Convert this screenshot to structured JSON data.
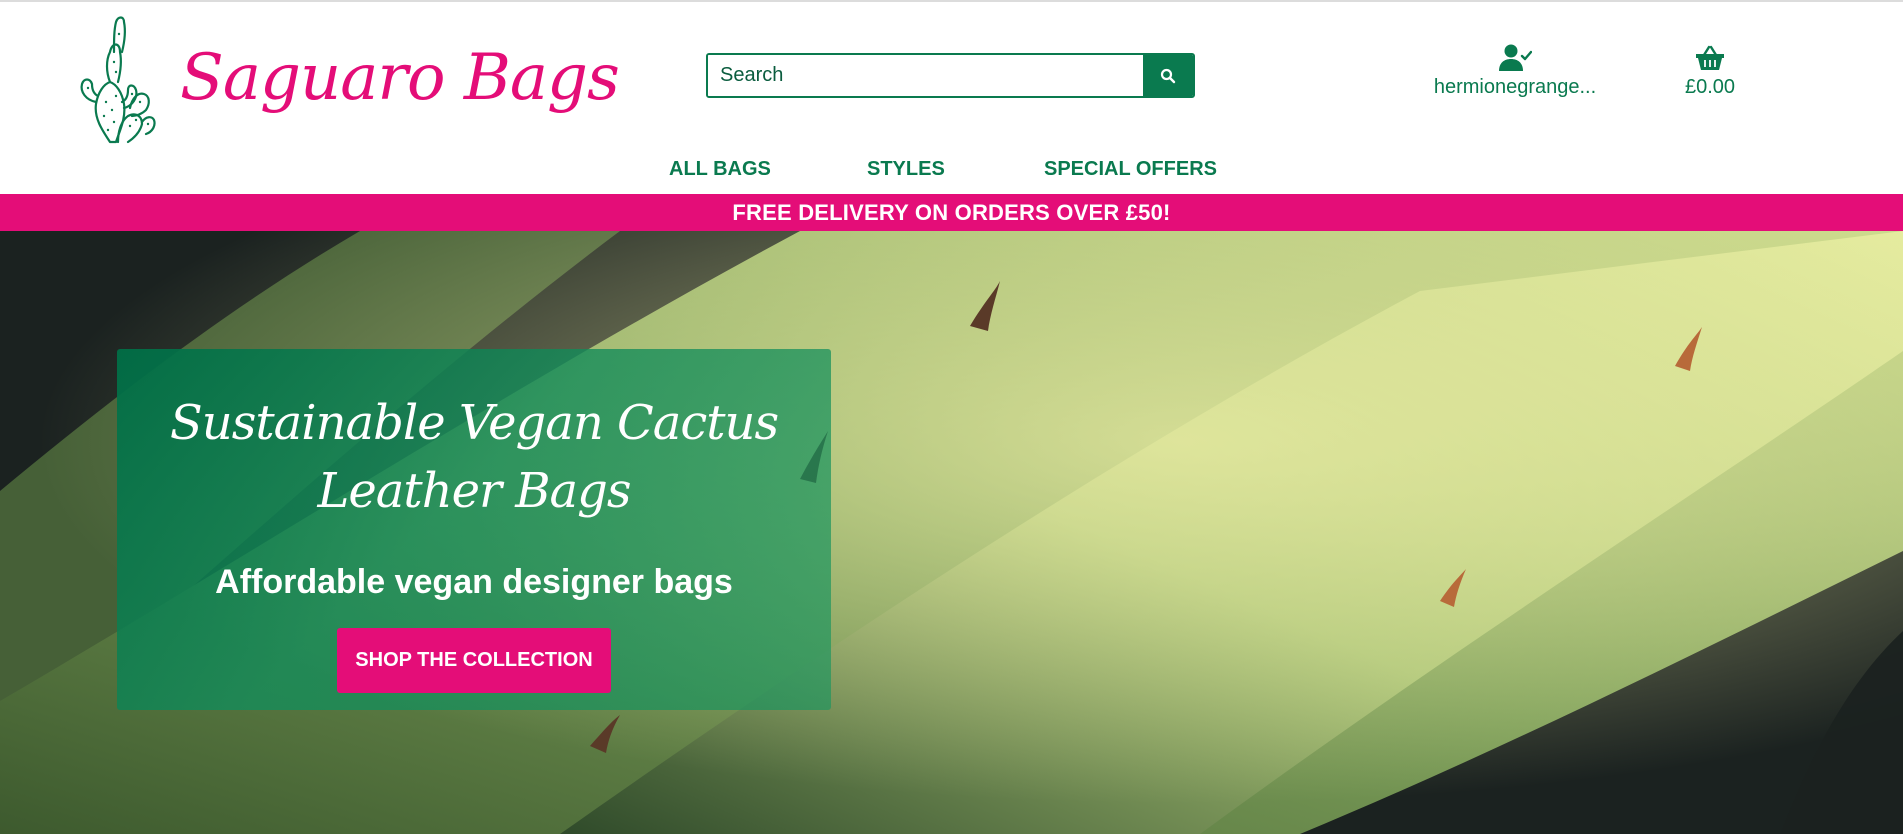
{
  "header": {
    "brand_name": "Saguaro Bags",
    "search": {
      "placeholder": "Search"
    },
    "account": {
      "username": "hermionegrange..."
    },
    "cart": {
      "total": "£0.00"
    }
  },
  "nav": {
    "items": [
      {
        "label": "ALL BAGS"
      },
      {
        "label": "STYLES"
      },
      {
        "label": "SPECIAL OFFERS"
      }
    ]
  },
  "banner": {
    "text": "FREE DELIVERY ON ORDERS OVER £50!"
  },
  "hero": {
    "title": "Sustainable Vegan Cactus Leather Bags",
    "subtitle": "Affordable vegan designer bags",
    "cta_label": "SHOP THE COLLECTION"
  },
  "icons": {
    "logo": "cactus-icon",
    "search_button": "search-icon",
    "account": "user-check-icon",
    "cart": "basket-icon"
  },
  "colors": {
    "brand_green": "#0a7a4f",
    "brand_pink": "#e40d78",
    "banner_text": "#ffffff"
  }
}
